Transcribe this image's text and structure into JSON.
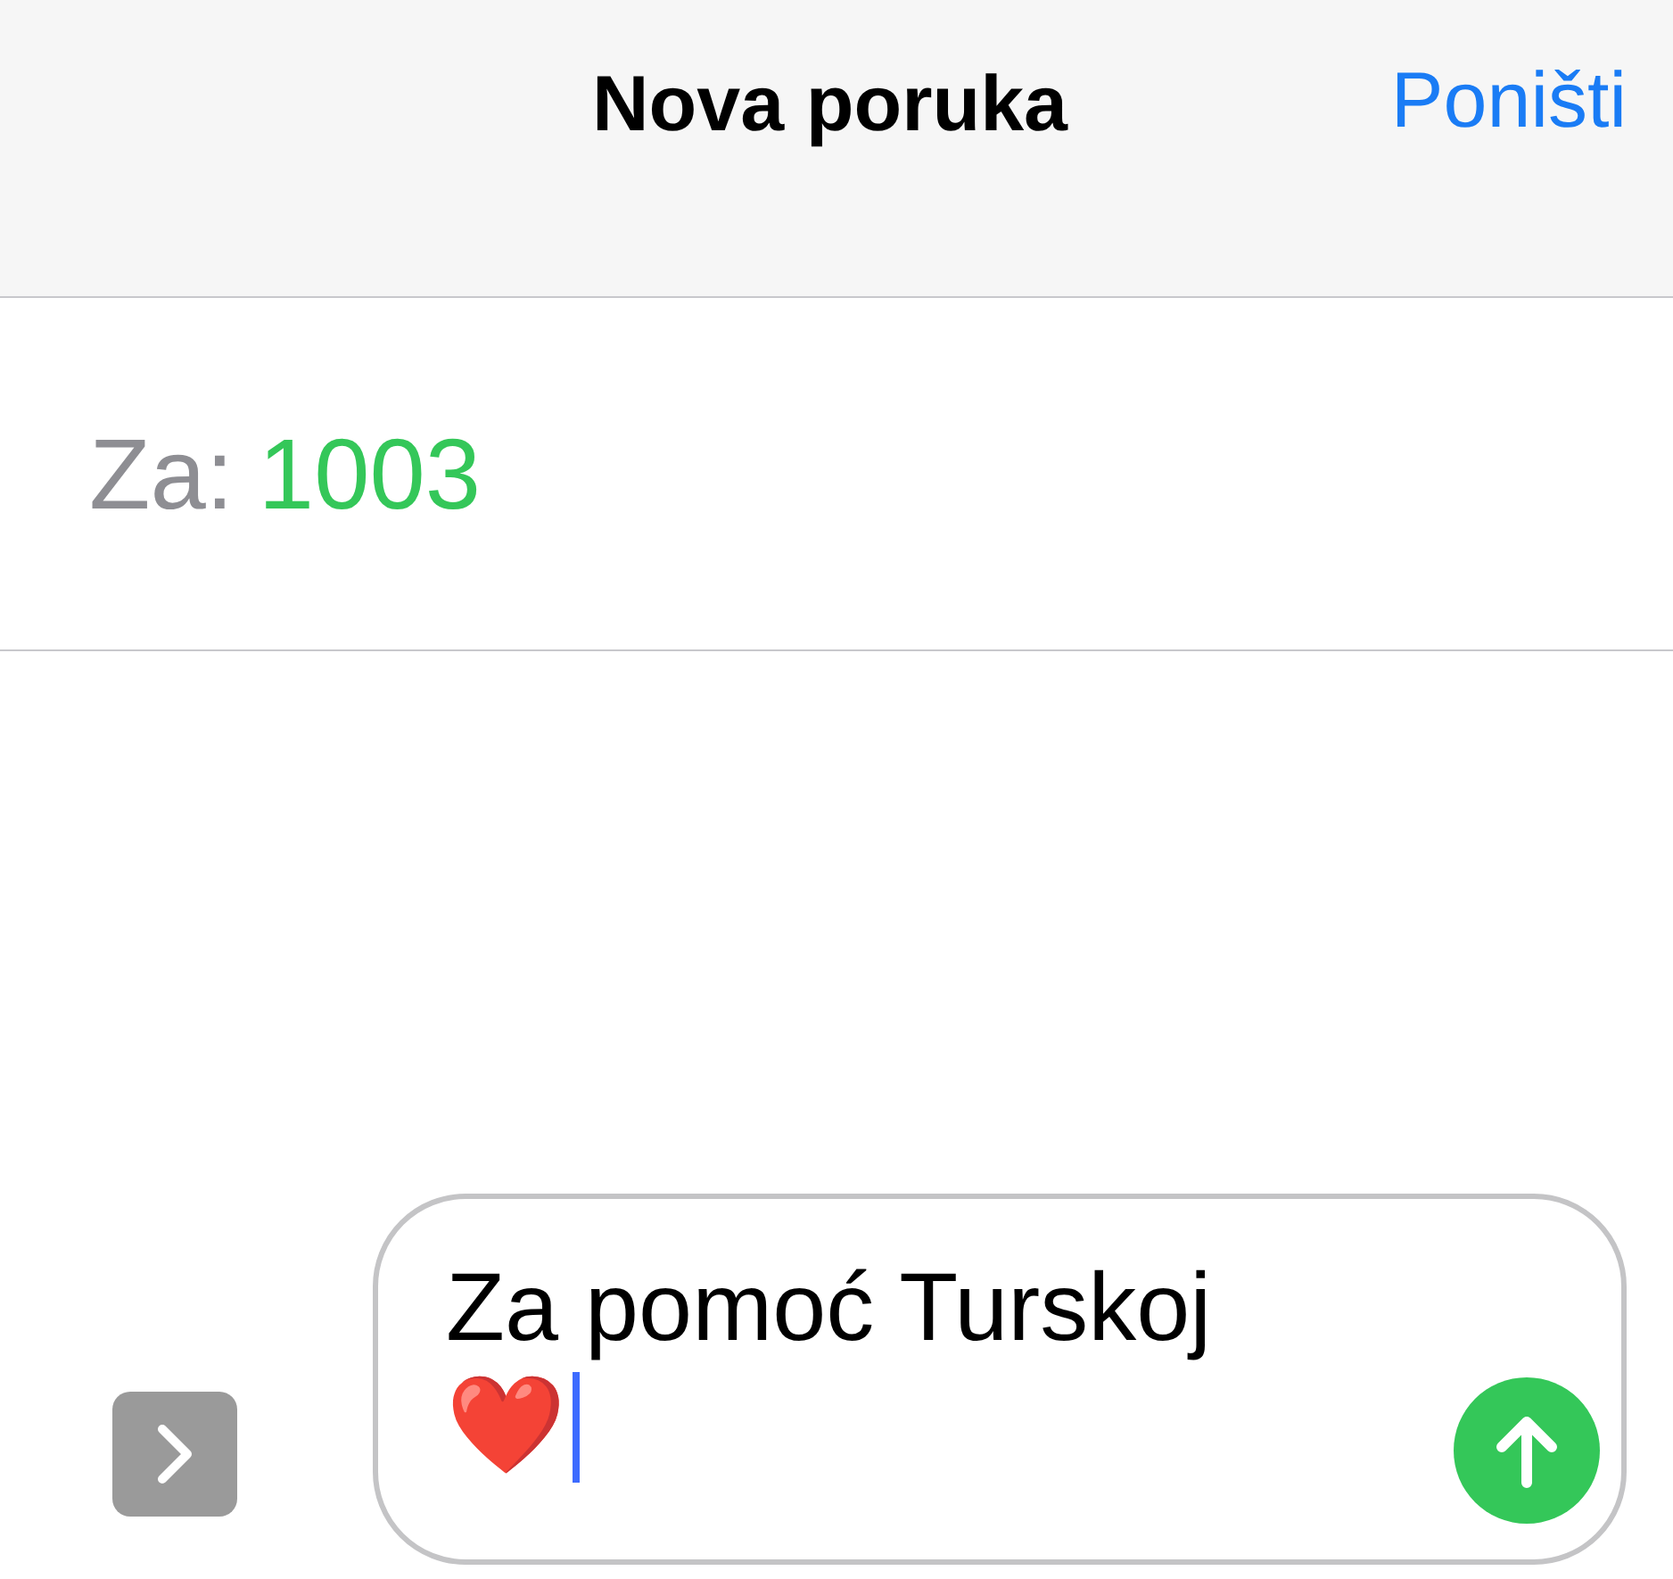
{
  "header": {
    "title": "Nova poruka",
    "cancel": "Poništi"
  },
  "recipient": {
    "label": "Za:",
    "value": "1003"
  },
  "composer": {
    "text": "Za pomoć Turskoj",
    "emoji": "❤️",
    "focused": true
  }
}
